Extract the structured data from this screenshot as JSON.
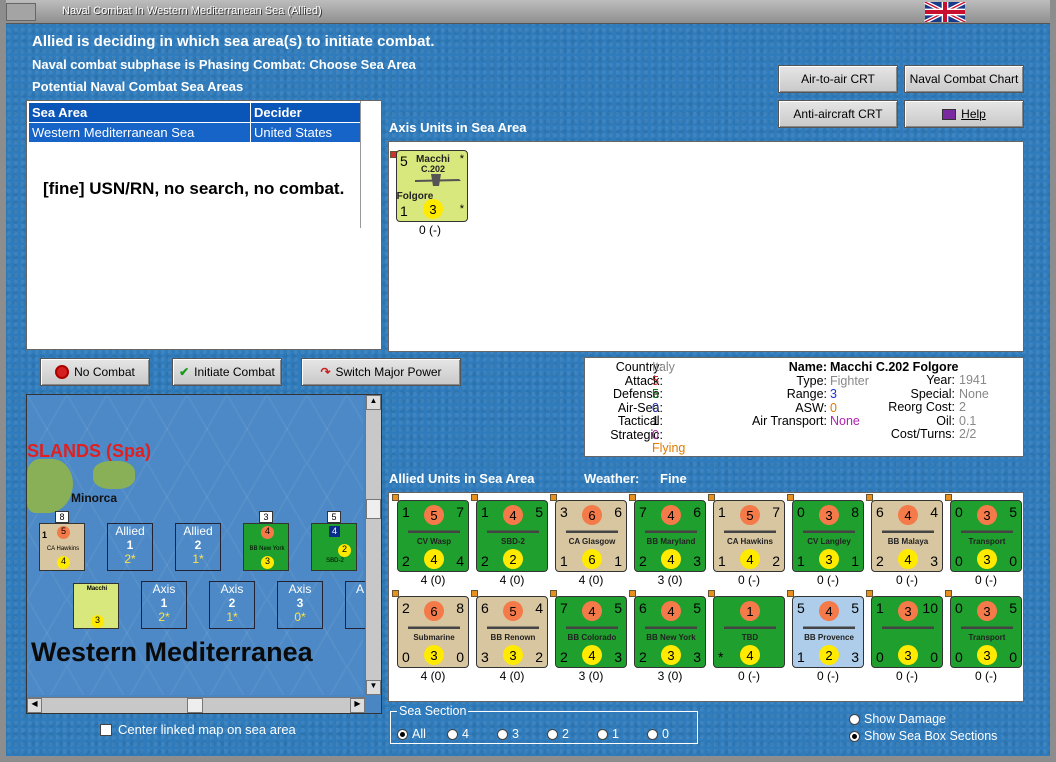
{
  "window": {
    "title": "Naval Combat In Western Mediterranean Sea (Allied)"
  },
  "header": {
    "line1": "Allied is deciding in which sea area(s) to initiate combat.",
    "line2": "Naval combat subphase is Phasing Combat: Choose Sea Area",
    "line3": "Potential Naval Combat Sea Areas"
  },
  "buttons": {
    "air_to_air": "Air-to-air CRT",
    "naval_chart": "Naval Combat Chart",
    "anti_aircraft": "Anti-aircraft CRT",
    "help": "Help",
    "no_combat": "No Combat",
    "initiate": "Initiate Combat",
    "switch": "Switch Major Power"
  },
  "sea_table": {
    "headers": [
      "Sea Area",
      "Decider"
    ],
    "rows": [
      [
        "Western Mediterranean Sea",
        "United States"
      ]
    ],
    "result": "[fine]  USN/RN, no search, no combat."
  },
  "axis_area": {
    "label": "Axis Units in Sea Area"
  },
  "axis_unit": {
    "top": "5",
    "name1": "Macchi",
    "name2": "C.202",
    "sub": "Folgore",
    "b1": "1",
    "b2": "3",
    "count": "0 (-)"
  },
  "info": {
    "country_l": "Country:",
    "country": "Italy",
    "attack_l": "Attack:",
    "attack": "5",
    "defense_l": "Defense:",
    "defense": "5",
    "airsea_l": "Air-Sea:",
    "airsea": "0",
    "tactical_l": "Tactical:",
    "tactical": "1",
    "strategic_l": "Strategic:",
    "strategic": "0",
    "flying": "Flying",
    "name_l": "Name:",
    "name": "Macchi C.202 Folgore",
    "type_l": "Type:",
    "type": "Fighter",
    "range_l": "Range:",
    "range": "3",
    "asw_l": "ASW:",
    "asw": "0",
    "airtransport_l": "Air Transport:",
    "airtransport": "None",
    "year_l": "Year:",
    "year": "1941",
    "special_l": "Special:",
    "special": "None",
    "reorg_l": "Reorg Cost:",
    "reorg": "2",
    "oil_l": "Oil:",
    "oil": "0.1",
    "costturns_l": "Cost/Turns:",
    "costturns": "2/2"
  },
  "allied_area": {
    "label": "Allied Units in Sea Area",
    "weather_label": "Weather:",
    "weather": "Fine"
  },
  "allied_units": [
    {
      "name": "CV Wasp",
      "color": "green",
      "tl": "1",
      "top": "5",
      "tr": "7",
      "bl": "2",
      "bot": "4",
      "br": "4",
      "count": "4 (0)"
    },
    {
      "name": "SBD-2",
      "color": "green",
      "tl": "1",
      "top": "4",
      "tr": "5",
      "bl": "2",
      "bot": "2",
      "br": "",
      "count": "4 (0)"
    },
    {
      "name": "CA Glasgow",
      "color": "tan",
      "tl": "3",
      "top": "6",
      "tr": "6",
      "bl": "1",
      "bot": "6",
      "br": "1",
      "count": "4 (0)"
    },
    {
      "name": "BB Maryland",
      "color": "green",
      "tl": "7",
      "top": "4",
      "tr": "6",
      "bl": "2",
      "bot": "4",
      "br": "3",
      "count": "3 (0)"
    },
    {
      "name": "CA Hawkins",
      "color": "tan",
      "tl": "1",
      "top": "5",
      "tr": "7",
      "bl": "1",
      "bot": "4",
      "br": "2",
      "count": "0 (-)"
    },
    {
      "name": "CV Langley",
      "color": "green",
      "tl": "0",
      "top": "3",
      "tr": "8",
      "bl": "1",
      "bot": "3",
      "br": "1",
      "count": "0 (-)"
    },
    {
      "name": "BB Malaya",
      "color": "tan",
      "tl": "6",
      "top": "4",
      "tr": "4",
      "bl": "2",
      "bot": "4",
      "br": "3",
      "count": "0 (-)"
    },
    {
      "name": "Transport",
      "color": "green",
      "tl": "0",
      "top": "3",
      "tr": "5",
      "bl": "0",
      "bot": "3",
      "br": "0",
      "count": "0 (-)"
    },
    {
      "name": "Submarine",
      "color": "tan",
      "tl": "2",
      "top": "6",
      "tr": "8",
      "bl": "0",
      "bot": "3",
      "br": "0",
      "count": "4 (0)"
    },
    {
      "name": "BB Renown",
      "color": "tan",
      "tl": "6",
      "top": "5",
      "tr": "4",
      "bl": "3",
      "bot": "3",
      "br": "2",
      "count": "4 (0)"
    },
    {
      "name": "BB Colorado",
      "color": "green",
      "tl": "7",
      "top": "4",
      "tr": "5",
      "bl": "2",
      "bot": "4",
      "br": "3",
      "count": "3 (0)"
    },
    {
      "name": "BB New York",
      "color": "green",
      "tl": "6",
      "top": "4",
      "tr": "5",
      "bl": "2",
      "bot": "3",
      "br": "3",
      "count": "3 (0)"
    },
    {
      "name": "TBD",
      "color": "green",
      "tl": "",
      "top": "1",
      "tr": "",
      "bl": "*",
      "bot": "4",
      "br": "",
      "count": "0 (-)"
    },
    {
      "name": "BB Provence",
      "color": "lblue",
      "tl": "5",
      "top": "4",
      "tr": "5",
      "bl": "1",
      "bot": "2",
      "br": "3",
      "count": "0 (-)"
    },
    {
      "name": "",
      "color": "green",
      "tl": "1",
      "top": "3",
      "tr": "10",
      "bl": "0",
      "bot": "3",
      "br": "0",
      "count": "0 (-)"
    },
    {
      "name": "Transport",
      "color": "green",
      "tl": "0",
      "top": "3",
      "tr": "5",
      "bl": "0",
      "bot": "3",
      "br": "0",
      "count": "0 (-)"
    }
  ],
  "map": {
    "islands": "SLANDS (Spa)",
    "minorca": "Minorca",
    "sea_name": "Western Mediterranea",
    "allied_boxes": [
      {
        "label": "Allied",
        "n": "1",
        "s": "2*"
      },
      {
        "label": "Allied",
        "n": "2",
        "s": "1*"
      }
    ],
    "axis_boxes": [
      {
        "label": "Axis",
        "n": "1",
        "s": "2*"
      },
      {
        "label": "Axis",
        "n": "2",
        "s": "1*"
      },
      {
        "label": "Axis",
        "n": "3",
        "s": "0*"
      },
      {
        "label": "A"
      }
    ],
    "stack_counts": [
      "8",
      "3",
      "5"
    ],
    "hawkins_label": "CA Hawkins",
    "newyork_label": "BB New York",
    "sbd_label": "SBD-2"
  },
  "center_link": "Center linked map on sea area",
  "sea_section": {
    "label": "Sea Section",
    "options": [
      "All",
      "4",
      "3",
      "2",
      "1",
      "0"
    ],
    "selected": "All"
  },
  "show": {
    "damage": "Show Damage",
    "boxes": "Show Sea Box Sections"
  }
}
